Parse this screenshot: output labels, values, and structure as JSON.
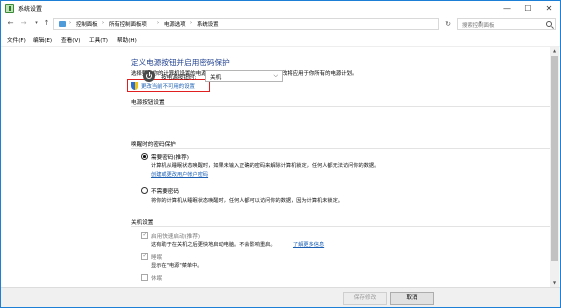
{
  "window": {
    "title": "系统设置",
    "minimize": "—",
    "maximize": "☐",
    "close": "✕"
  },
  "nav": {
    "back": "←",
    "forward": "→",
    "recent": "▾",
    "up": "↑",
    "refresh": "↻"
  },
  "breadcrumbs": [
    "控制面板",
    "所有控制面板项",
    "电源选项",
    "系统设置"
  ],
  "breadcrumb_sep": "›",
  "address_dropdown": "▾",
  "search": {
    "placeholder": "搜索控制面板"
  },
  "menu": [
    "文件(F)",
    "编辑(E)",
    "查看(V)",
    "工具(T)",
    "帮助(H)"
  ],
  "main": {
    "heading": "定义电源按钮并启用密码保护",
    "description": "选择要为你的计算机设置的电源设置。在此页上对设置所做的更改将应用于你所有的电源计划。",
    "change_link": "更改当前不可用的设置",
    "power_section": {
      "title": "电源按钮设置",
      "label": "按电源按钮时:",
      "value": "关机",
      "chevron": "⌵"
    },
    "wake_section": {
      "title": "唤醒时的密码保护",
      "options": [
        {
          "label": "需要密码(推荐)",
          "checked": true,
          "desc1": "计算机从睡眠状态唤醒时，如果未输入正确的密码来解除计算机锁定，任何人都无法访问你的数据。",
          "link": "创建或更改用户帐户密码"
        },
        {
          "label": "不需要密码",
          "checked": false,
          "desc1": "将你的计算机从睡眠状态唤醒时，任何人都可以访问你的数据，因为计算机未锁定。"
        }
      ]
    },
    "shutdown_section": {
      "title": "关机设置",
      "items": [
        {
          "label": "启用快速启动(推荐)",
          "checked": true,
          "desc": "这有助于在关机之后更快地启动电脑。不会影响重启。",
          "link": "了解更多信息"
        },
        {
          "label": "睡眠",
          "checked": true,
          "desc": "显示在\"电源\"菜单中。"
        },
        {
          "label": "休眠",
          "checked": false
        }
      ]
    }
  },
  "scrollbar": {
    "up": "▲",
    "down": "▼"
  },
  "footer": {
    "save": "保存修改",
    "cancel": "取消"
  }
}
